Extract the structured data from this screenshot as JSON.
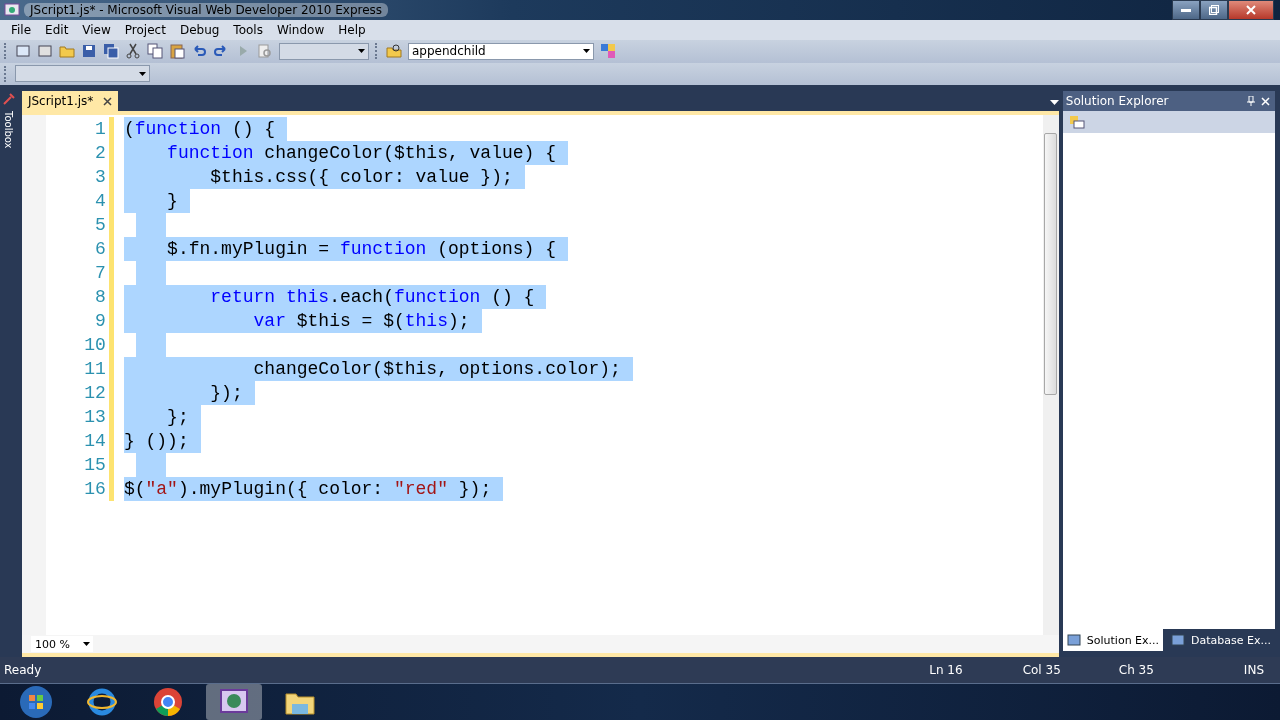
{
  "window": {
    "title": "JScript1.js* - Microsoft Visual Web Developer 2010 Express"
  },
  "menu": [
    "File",
    "Edit",
    "View",
    "Project",
    "Debug",
    "Tools",
    "Window",
    "Help"
  ],
  "toolbar": {
    "find_combo": {
      "value": "appendchild"
    }
  },
  "toolbox": {
    "label": "Toolbox"
  },
  "editor": {
    "tabs": [
      {
        "label": "JScript1.js*",
        "selected": true
      }
    ],
    "lines": [
      {
        "number": "1",
        "selected": true,
        "tokens": [
          {
            "kind": "plain",
            "text": "("
          },
          {
            "kind": "keyword",
            "text": "function"
          },
          {
            "kind": "plain",
            "text": " () {"
          }
        ]
      },
      {
        "number": "2",
        "selected": true,
        "tokens": [
          {
            "kind": "keyword",
            "text": "    function"
          },
          {
            "kind": "plain",
            "text": " changeColor($this, value) {"
          }
        ]
      },
      {
        "number": "3",
        "selected": true,
        "tokens": [
          {
            "kind": "plain",
            "text": "        $this.css({ color: value });"
          }
        ]
      },
      {
        "number": "4",
        "selected": true,
        "tokens": [
          {
            "kind": "plain",
            "text": "    }"
          }
        ]
      },
      {
        "number": "5",
        "selected": true
      },
      {
        "number": "6",
        "selected": true,
        "tokens": [
          {
            "kind": "plain",
            "text": "    $.fn.myPlugin = "
          },
          {
            "kind": "keyword",
            "text": "function"
          },
          {
            "kind": "plain",
            "text": " (options) {"
          }
        ]
      },
      {
        "number": "7",
        "selected": true
      },
      {
        "number": "8",
        "selected": true,
        "tokens": [
          {
            "kind": "keyword",
            "text": "        return"
          },
          {
            "kind": "keyword",
            "text": " this"
          },
          {
            "kind": "plain",
            "text": ".each("
          },
          {
            "kind": "keyword",
            "text": "function"
          },
          {
            "kind": "plain",
            "text": " () {"
          }
        ]
      },
      {
        "number": "9",
        "selected": true,
        "tokens": [
          {
            "kind": "keyword",
            "text": "            var"
          },
          {
            "kind": "plain",
            "text": " $this = $("
          },
          {
            "kind": "keyword",
            "text": "this"
          },
          {
            "kind": "plain",
            "text": ");"
          }
        ]
      },
      {
        "number": "10",
        "selected": true
      },
      {
        "number": "11",
        "selected": true,
        "tokens": [
          {
            "kind": "plain",
            "text": "            changeColor($this, options.color);"
          }
        ]
      },
      {
        "number": "12",
        "selected": true,
        "tokens": [
          {
            "kind": "plain",
            "text": "        });"
          }
        ]
      },
      {
        "number": "13",
        "selected": true,
        "tokens": [
          {
            "kind": "plain",
            "text": "    };"
          }
        ]
      },
      {
        "number": "14",
        "selected": true,
        "tokens": [
          {
            "kind": "plain",
            "text": "} ());"
          }
        ]
      },
      {
        "number": "15",
        "selected": true
      },
      {
        "number": "16",
        "selected": true,
        "tokens": [
          {
            "kind": "plain",
            "text": "$("
          },
          {
            "kind": "string",
            "text": "\"a\""
          },
          {
            "kind": "plain",
            "text": ").myPlugin({ color: "
          },
          {
            "kind": "string",
            "text": "\"red\""
          },
          {
            "kind": "plain",
            "text": " });"
          }
        ]
      }
    ],
    "zoom": "100 %"
  },
  "solution_explorer": {
    "title": "Solution Explorer"
  },
  "dock_tabs": [
    {
      "label": "Solution Ex...",
      "selected": true
    },
    {
      "label": "Database Ex...",
      "selected": false
    }
  ],
  "status_bar": {
    "message": "Ready",
    "line": "Ln 16",
    "column": "Col 35",
    "char": "Ch 35",
    "mode": "INS"
  }
}
